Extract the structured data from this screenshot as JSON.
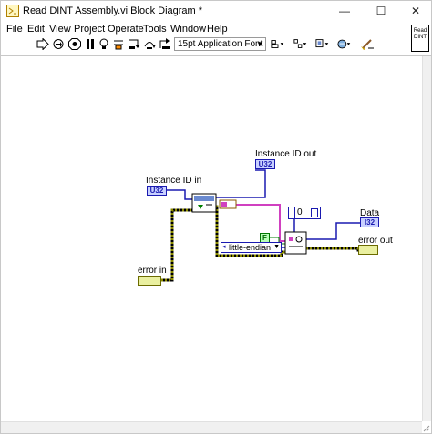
{
  "window": {
    "title": "Read DINT Assembly.vi Block Diagram *",
    "minimize": "—",
    "maximize": "☐",
    "close": "✕"
  },
  "menu": [
    "File",
    "Edit",
    "View",
    "Project",
    "Operate",
    "Tools",
    "Window",
    "Help"
  ],
  "toolbar": {
    "font": "15pt Application Font"
  },
  "connector_pane": {
    "line1": "Read",
    "line2": "DINT"
  },
  "diagram": {
    "instance_id_in": {
      "label": "Instance ID in",
      "type": "U32"
    },
    "instance_id_out": {
      "label": "Instance ID out",
      "type": "U32"
    },
    "data": {
      "label": "Data",
      "type": "I32"
    },
    "error_in": {
      "label": "error in"
    },
    "error_out": {
      "label": "error out"
    },
    "endian": {
      "value": "little-endian"
    },
    "const_zero": "0",
    "bool_const": "F"
  },
  "colors": {
    "numeric_wire": "#1a1ab0",
    "error_wire": "#8a8a00",
    "variant_wire": "#d040c0",
    "bool_wire": "#008000"
  }
}
